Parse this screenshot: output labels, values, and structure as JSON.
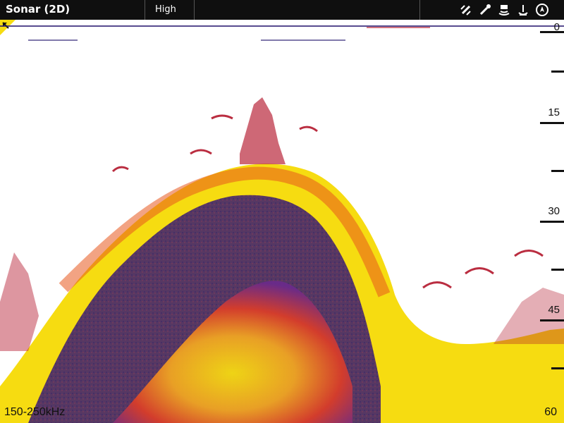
{
  "header": {
    "title": "Sonar (2D)",
    "mode": "High",
    "icons": [
      "gps-icon",
      "wrench-icon",
      "transducer-icon",
      "anchor-icon",
      "compass-icon"
    ]
  },
  "sonar": {
    "frequency": "150-250kHz",
    "scale_labels": [
      "0",
      "15",
      "30",
      "45"
    ],
    "depth_bottom": "60"
  },
  "colors": {
    "topbar": "#0f0f0f",
    "bottom_yellow": "#f6dc11",
    "bottom_orange": "#e8581e",
    "bottom_purple": "#3a1b72",
    "clutter_red": "#b3172c"
  }
}
